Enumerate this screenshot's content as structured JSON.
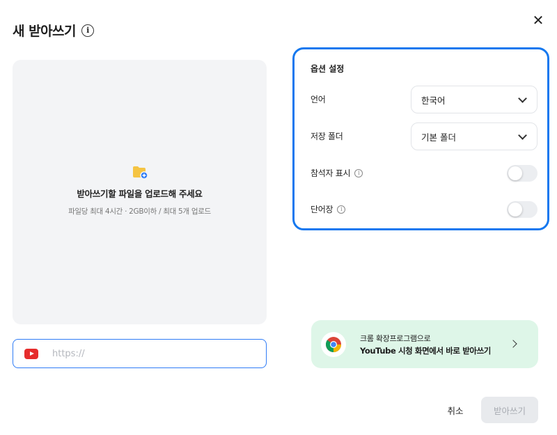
{
  "dialog": {
    "title": "새 받아쓰기",
    "info_icon": "info-icon",
    "close_icon": "close-icon",
    "close_glyph": "✕"
  },
  "upload": {
    "icon": "folder-add-icon",
    "main_text": "받아쓰기할 파일을 업로드해 주세요",
    "sub_text": "파일당 최대 4시간 · 2GB이하 / 최대 5개 업로드"
  },
  "url": {
    "icon": "youtube-icon",
    "placeholder": "https://",
    "value": ""
  },
  "options": {
    "title": "옵션 설정",
    "language": {
      "label": "언어",
      "value": "한국어"
    },
    "folder": {
      "label": "저장 폴더",
      "value": "기본 폴더"
    },
    "speaker": {
      "label": "참석자 표시",
      "enabled": false
    },
    "vocabulary": {
      "label": "단어장",
      "enabled": false
    }
  },
  "promo": {
    "icon": "chrome-icon",
    "line1": "크롬 확장프로그램으로",
    "line2": "YouTube 시청 화면에서 바로 받아쓰기"
  },
  "actions": {
    "cancel": "취소",
    "submit": "받아쓰기"
  },
  "colors": {
    "accent_border": "#1578ef",
    "url_border": "#2f7cf6",
    "promo_bg": "#def6e8",
    "youtube_red": "#e62d2d",
    "folder_yellow": "#f5c443"
  }
}
